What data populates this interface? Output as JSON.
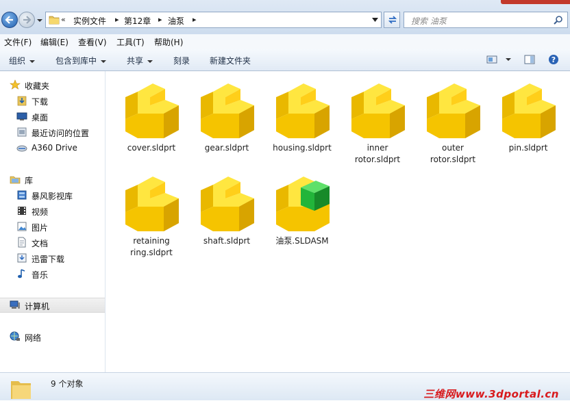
{
  "address": {
    "overflow_chevron": "«",
    "crumbs": [
      "实例文件",
      "第12章",
      "油泵"
    ]
  },
  "search": {
    "placeholder": "搜索 油泵"
  },
  "menu": [
    "文件(F)",
    "编辑(E)",
    "查看(V)",
    "工具(T)",
    "帮助(H)"
  ],
  "toolbar": {
    "organize": "组织",
    "include_library": "包含到库中",
    "share": "共享",
    "burn": "刻录",
    "new_folder": "新建文件夹"
  },
  "nav": {
    "favorites": "收藏夹",
    "downloads": "下载",
    "desktop": "桌面",
    "recent": "最近访问的位置",
    "a360": "A360 Drive",
    "library": "库",
    "baofeng": "暴风影视库",
    "videos": "视频",
    "pictures": "图片",
    "documents": "文档",
    "xunlei": "迅雷下载",
    "music": "音乐",
    "computer": "计算机",
    "network": "网络"
  },
  "files": [
    {
      "name": "cover.sldprt",
      "type": "part"
    },
    {
      "name": "gear.sldprt",
      "type": "part"
    },
    {
      "name": "housing.sldprt",
      "type": "part"
    },
    {
      "name": "inner rotor.sldprt",
      "type": "part"
    },
    {
      "name": "outer rotor.sldprt",
      "type": "part"
    },
    {
      "name": "pin.sldprt",
      "type": "part"
    },
    {
      "name": "retaining ring.sldprt",
      "type": "part"
    },
    {
      "name": "shaft.sldprt",
      "type": "part"
    },
    {
      "name": "油泵.SLDASM",
      "type": "assembly"
    }
  ],
  "status": {
    "count_text": "9 个对象"
  },
  "watermark": "三维网www.3dportal.cn",
  "colors": {
    "part_yellow": "#f5c400",
    "assembly_green": "#22b53a",
    "accent": "#1f5fae"
  }
}
